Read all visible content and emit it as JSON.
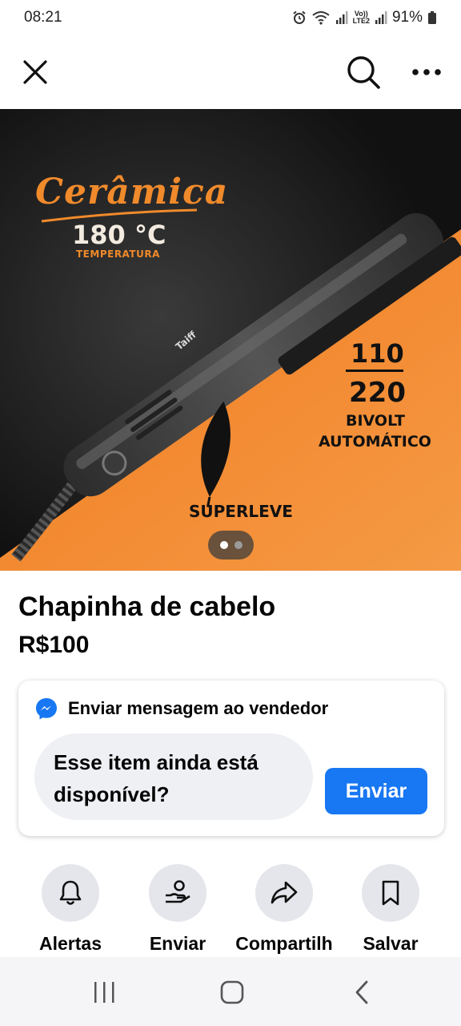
{
  "status_bar": {
    "time": "08:21",
    "lte_top": "Vo))",
    "lte_bottom": "LTE2",
    "battery": "91%",
    "icons": [
      "alarm-icon",
      "wifi-icon",
      "signal-icon",
      "battery-icon"
    ]
  },
  "toolbar": {
    "icons": [
      "close-icon",
      "search-icon",
      "more-icon"
    ]
  },
  "product_image": {
    "ceramica": "Cerâmica",
    "temperature": "180 °C",
    "temperature_label": "TEMPERATURA",
    "voltage_top": "110",
    "voltage_bottom": "220",
    "bivolt": "BIVOLT",
    "automatico": "AUTOMÁTICO",
    "superleve": "SUPERLEVE",
    "brand_logo": "Taiff",
    "page_count": 2,
    "current_page": 1
  },
  "product": {
    "title": "Chapinha de cabelo",
    "price": "R$100"
  },
  "message_card": {
    "header": "Enviar mensagem ao vendedor",
    "message": "Esse item ainda está disponível?",
    "send_label": "Enviar"
  },
  "actions": [
    {
      "label": "Alertas",
      "icon": "bell-icon"
    },
    {
      "label": "Enviar",
      "icon": "send-offer-icon"
    },
    {
      "label": "Compartilh",
      "icon": "share-icon"
    },
    {
      "label": "Salvar",
      "icon": "bookmark-icon"
    }
  ],
  "colors": {
    "accent": "#1877f2",
    "orange": "#f08a2b",
    "circle_bg": "#e4e6eb"
  }
}
